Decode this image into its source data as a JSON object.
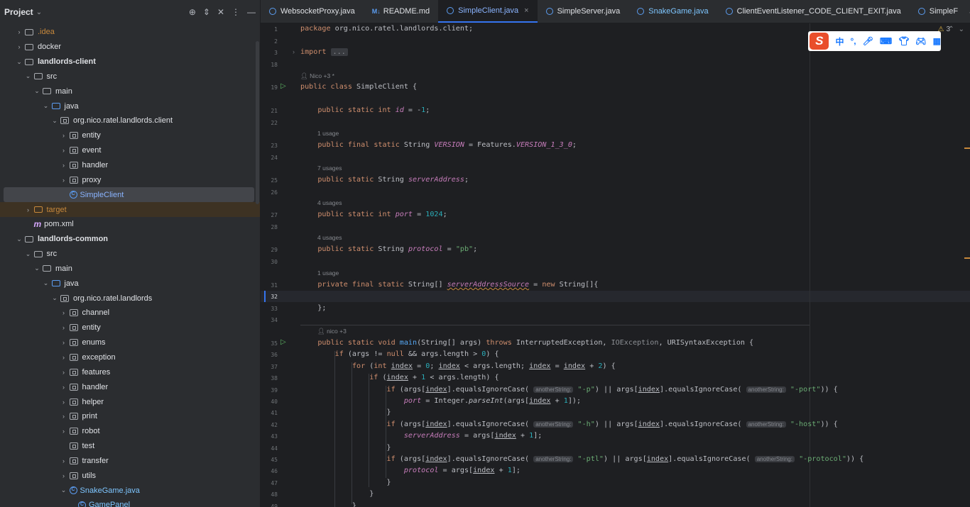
{
  "project_panel": {
    "title": "Project",
    "tree": [
      {
        "label": ".idea",
        "depth": 1,
        "arrow": "›",
        "icon": "folder",
        "style": "orange"
      },
      {
        "label": "docker",
        "depth": 1,
        "arrow": "›",
        "icon": "folder"
      },
      {
        "label": "landlords-client",
        "depth": 1,
        "arrow": "⌄",
        "icon": "folder",
        "style": "bold"
      },
      {
        "label": "src",
        "depth": 2,
        "arrow": "⌄",
        "icon": "folder"
      },
      {
        "label": "main",
        "depth": 3,
        "arrow": "⌄",
        "icon": "folder"
      },
      {
        "label": "java",
        "depth": 4,
        "arrow": "⌄",
        "icon": "folder-src"
      },
      {
        "label": "org.nico.ratel.landlords.client",
        "depth": 5,
        "arrow": "⌄",
        "icon": "package"
      },
      {
        "label": "entity",
        "depth": 6,
        "arrow": "›",
        "icon": "package"
      },
      {
        "label": "event",
        "depth": 6,
        "arrow": "›",
        "icon": "package"
      },
      {
        "label": "handler",
        "depth": 6,
        "arrow": "›",
        "icon": "package"
      },
      {
        "label": "proxy",
        "depth": 6,
        "arrow": "›",
        "icon": "package"
      },
      {
        "label": "SimpleClient",
        "depth": 6,
        "arrow": "",
        "icon": "class",
        "style": "blue",
        "selected": true
      },
      {
        "label": "target",
        "depth": 2,
        "arrow": "›",
        "icon": "folder-excluded",
        "style": "orange",
        "excluded": true
      },
      {
        "label": "pom.xml",
        "depth": 2,
        "arrow": "",
        "icon": "maven"
      },
      {
        "label": "landlords-common",
        "depth": 1,
        "arrow": "⌄",
        "icon": "folder",
        "style": "bold"
      },
      {
        "label": "src",
        "depth": 2,
        "arrow": "⌄",
        "icon": "folder"
      },
      {
        "label": "main",
        "depth": 3,
        "arrow": "⌄",
        "icon": "folder"
      },
      {
        "label": "java",
        "depth": 4,
        "arrow": "⌄",
        "icon": "folder-src"
      },
      {
        "label": "org.nico.ratel.landlords",
        "depth": 5,
        "arrow": "⌄",
        "icon": "package"
      },
      {
        "label": "channel",
        "depth": 6,
        "arrow": "›",
        "icon": "package"
      },
      {
        "label": "entity",
        "depth": 6,
        "arrow": "›",
        "icon": "package"
      },
      {
        "label": "enums",
        "depth": 6,
        "arrow": "›",
        "icon": "package"
      },
      {
        "label": "exception",
        "depth": 6,
        "arrow": "›",
        "icon": "package"
      },
      {
        "label": "features",
        "depth": 6,
        "arrow": "›",
        "icon": "package"
      },
      {
        "label": "handler",
        "depth": 6,
        "arrow": "›",
        "icon": "package"
      },
      {
        "label": "helper",
        "depth": 6,
        "arrow": "›",
        "icon": "package"
      },
      {
        "label": "print",
        "depth": 6,
        "arrow": "›",
        "icon": "package"
      },
      {
        "label": "robot",
        "depth": 6,
        "arrow": "›",
        "icon": "package"
      },
      {
        "label": "test",
        "depth": 6,
        "arrow": "",
        "icon": "package"
      },
      {
        "label": "transfer",
        "depth": 6,
        "arrow": "›",
        "icon": "package"
      },
      {
        "label": "utils",
        "depth": 6,
        "arrow": "›",
        "icon": "package"
      },
      {
        "label": "SnakeGame.java",
        "depth": 6,
        "arrow": "⌄",
        "icon": "class",
        "style": "green"
      },
      {
        "label": "GamePanel",
        "depth": 7,
        "arrow": "",
        "icon": "class",
        "style": "green"
      }
    ]
  },
  "tabs": [
    {
      "label": "WebsocketProxy.java",
      "icon": "class"
    },
    {
      "label": "README.md",
      "icon": "md",
      "icon_text": "M↓"
    },
    {
      "label": "SimpleClient.java",
      "icon": "class",
      "active": true,
      "closable": true
    },
    {
      "label": "SimpleServer.java",
      "icon": "class"
    },
    {
      "label": "SnakeGame.java",
      "icon": "class",
      "style": "green"
    },
    {
      "label": "ClientEventListener_CODE_CLIENT_EXIT.java",
      "icon": "class"
    },
    {
      "label": "SimpleF",
      "icon": "class"
    }
  ],
  "editor": {
    "warning_count": "3",
    "current_line": "32",
    "author_hint_1": "Nico +3 *",
    "author_hint_2": "nico +3",
    "usage_1": "1 usage",
    "usage_7": "7 usages",
    "usage_4a": "4 usages",
    "usage_4b": "4 usages",
    "usage_1b": "1 usage",
    "param_hint": "anotherString:",
    "ime_logo": "S",
    "ime_mode": "中"
  },
  "colors": {
    "accent": "#3574f0",
    "keyword": "#cf8e6d",
    "field": "#c77dbb",
    "number": "#2aacb8",
    "string": "#6aab73",
    "run_icon": "#5fb865"
  }
}
